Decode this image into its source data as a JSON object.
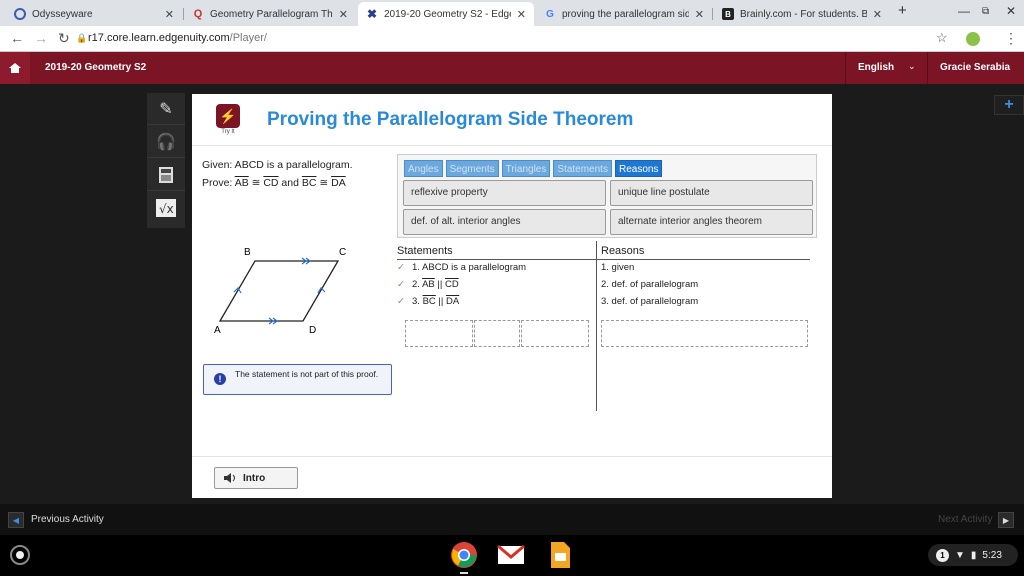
{
  "browser": {
    "tabs": [
      {
        "title": "Odysseyware",
        "icon": "odysseyware-icon"
      },
      {
        "title": "Geometry Parallelogram Theor",
        "icon": "quizlet-icon"
      },
      {
        "title": "2019-20 Geometry S2 - Edgenu",
        "icon": "edgenuity-icon",
        "active": true
      },
      {
        "title": "proving the parallelogram side t",
        "icon": "google-icon"
      },
      {
        "title": "Brainly.com - For students. By s",
        "icon": "brainly-icon"
      }
    ],
    "new_tab": "+",
    "url_host": "r17.core.learn.edgenuity.com",
    "url_path": "/Player/"
  },
  "header": {
    "course_title": "2019-20 Geometry S2",
    "language": "English",
    "user_name": "Gracie Serabia"
  },
  "lesson": {
    "tryit_label": "Try It",
    "title": "Proving the Parallelogram Side Theorem",
    "given_prefix": "Given: ABCD is a parallelogram.",
    "prove_prefix": "Prove: ",
    "prove_ab": "AB",
    "prove_cong1": " ≅ ",
    "prove_cd": "CD",
    "prove_and": " and ",
    "prove_bc": "BC",
    "prove_cong2": " ≅ ",
    "prove_da": "DA"
  },
  "category_tabs": [
    "Angles",
    "Segments",
    "Triangles",
    "Statements",
    "Reasons"
  ],
  "active_category": "Reasons",
  "choices": [
    "reflexive property",
    "unique line postulate",
    "def. of alt. interior angles",
    "alternate interior angles theorem"
  ],
  "proof": {
    "statements_header": "Statements",
    "reasons_header": "Reasons",
    "statements": [
      {
        "check": "✓",
        "num": "1.",
        "pre": " ABCD is a parallelogram",
        "a": "",
        "mid": "",
        "b": ""
      },
      {
        "check": "✓",
        "num": "2.",
        "pre": " ",
        "a": "AB",
        "mid": " || ",
        "b": "CD"
      },
      {
        "check": "✓",
        "num": "3.",
        "pre": " ",
        "a": "BC",
        "mid": " || ",
        "b": "DA"
      }
    ],
    "reasons": [
      "1. given",
      "2. def. of parallelogram",
      "3. def. of parallelogram"
    ]
  },
  "diagram": {
    "labels": {
      "A": "A",
      "B": "B",
      "C": "C",
      "D": "D"
    }
  },
  "alert": {
    "icon": "!",
    "text": "The statement is not part of this proof."
  },
  "footer": {
    "intro_label": "Intro"
  },
  "activity_nav": {
    "previous": "Previous Activity",
    "next": "Next Activity"
  },
  "system_tray": {
    "notification_count": "1",
    "time": "5:23"
  },
  "colors": {
    "header_bg": "#7b1425",
    "title_blue": "#2a8ad8",
    "tab_active": "#1e78d2",
    "check_green": "#5aa85a"
  }
}
